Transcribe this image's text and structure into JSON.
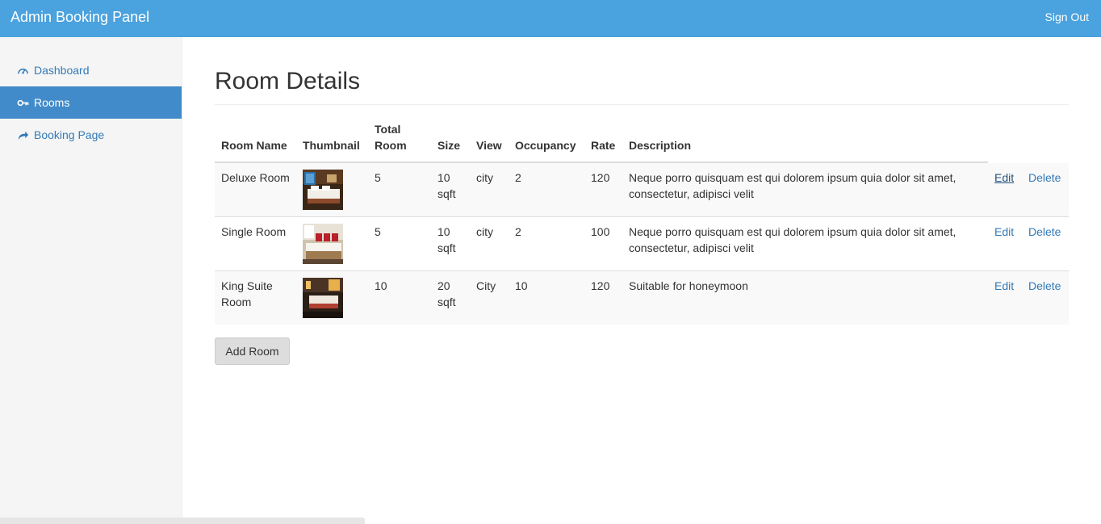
{
  "header": {
    "brand": "Admin Booking Panel",
    "signout_label": "Sign Out",
    "bg_color": "#4aa2de"
  },
  "sidebar": {
    "items": [
      {
        "label": "Dashboard",
        "icon": "dashboard-icon",
        "active": false
      },
      {
        "label": "Rooms",
        "icon": "key-icon",
        "active": true
      },
      {
        "label": "Booking Page",
        "icon": "share-arrow-icon",
        "active": false
      }
    ]
  },
  "main": {
    "title": "Room Details",
    "columns": [
      "Room Name",
      "Thumbnail",
      "Total Room",
      "Size",
      "View",
      "Occupancy",
      "Rate",
      "Description"
    ],
    "rows": [
      {
        "name": "Deluxe Room",
        "thumbnail": "room-photo",
        "total": "5",
        "size": "10 sqft",
        "view": "city",
        "occupancy": "2",
        "rate": "120",
        "description": "Neque porro quisquam est qui dolorem ipsum quia dolor sit amet, consectetur, adipisci velit",
        "edit": "Edit",
        "delete": "Delete"
      },
      {
        "name": "Single Room",
        "thumbnail": "room-photo",
        "total": "5",
        "size": "10 sqft",
        "view": "city",
        "occupancy": "2",
        "rate": "100",
        "description": "Neque porro quisquam est qui dolorem ipsum quia dolor sit amet, consectetur, adipisci velit",
        "edit": "Edit",
        "delete": "Delete"
      },
      {
        "name": "King Suite Room",
        "thumbnail": "room-photo",
        "total": "10",
        "size": "20 sqft",
        "view": "City",
        "occupancy": "10",
        "rate": "120",
        "description": "Suitable for honeymoon",
        "edit": "Edit",
        "delete": "Delete"
      }
    ],
    "add_button": "Add Room"
  },
  "colors": {
    "link": "#337ab7",
    "active_nav": "#428bca"
  }
}
